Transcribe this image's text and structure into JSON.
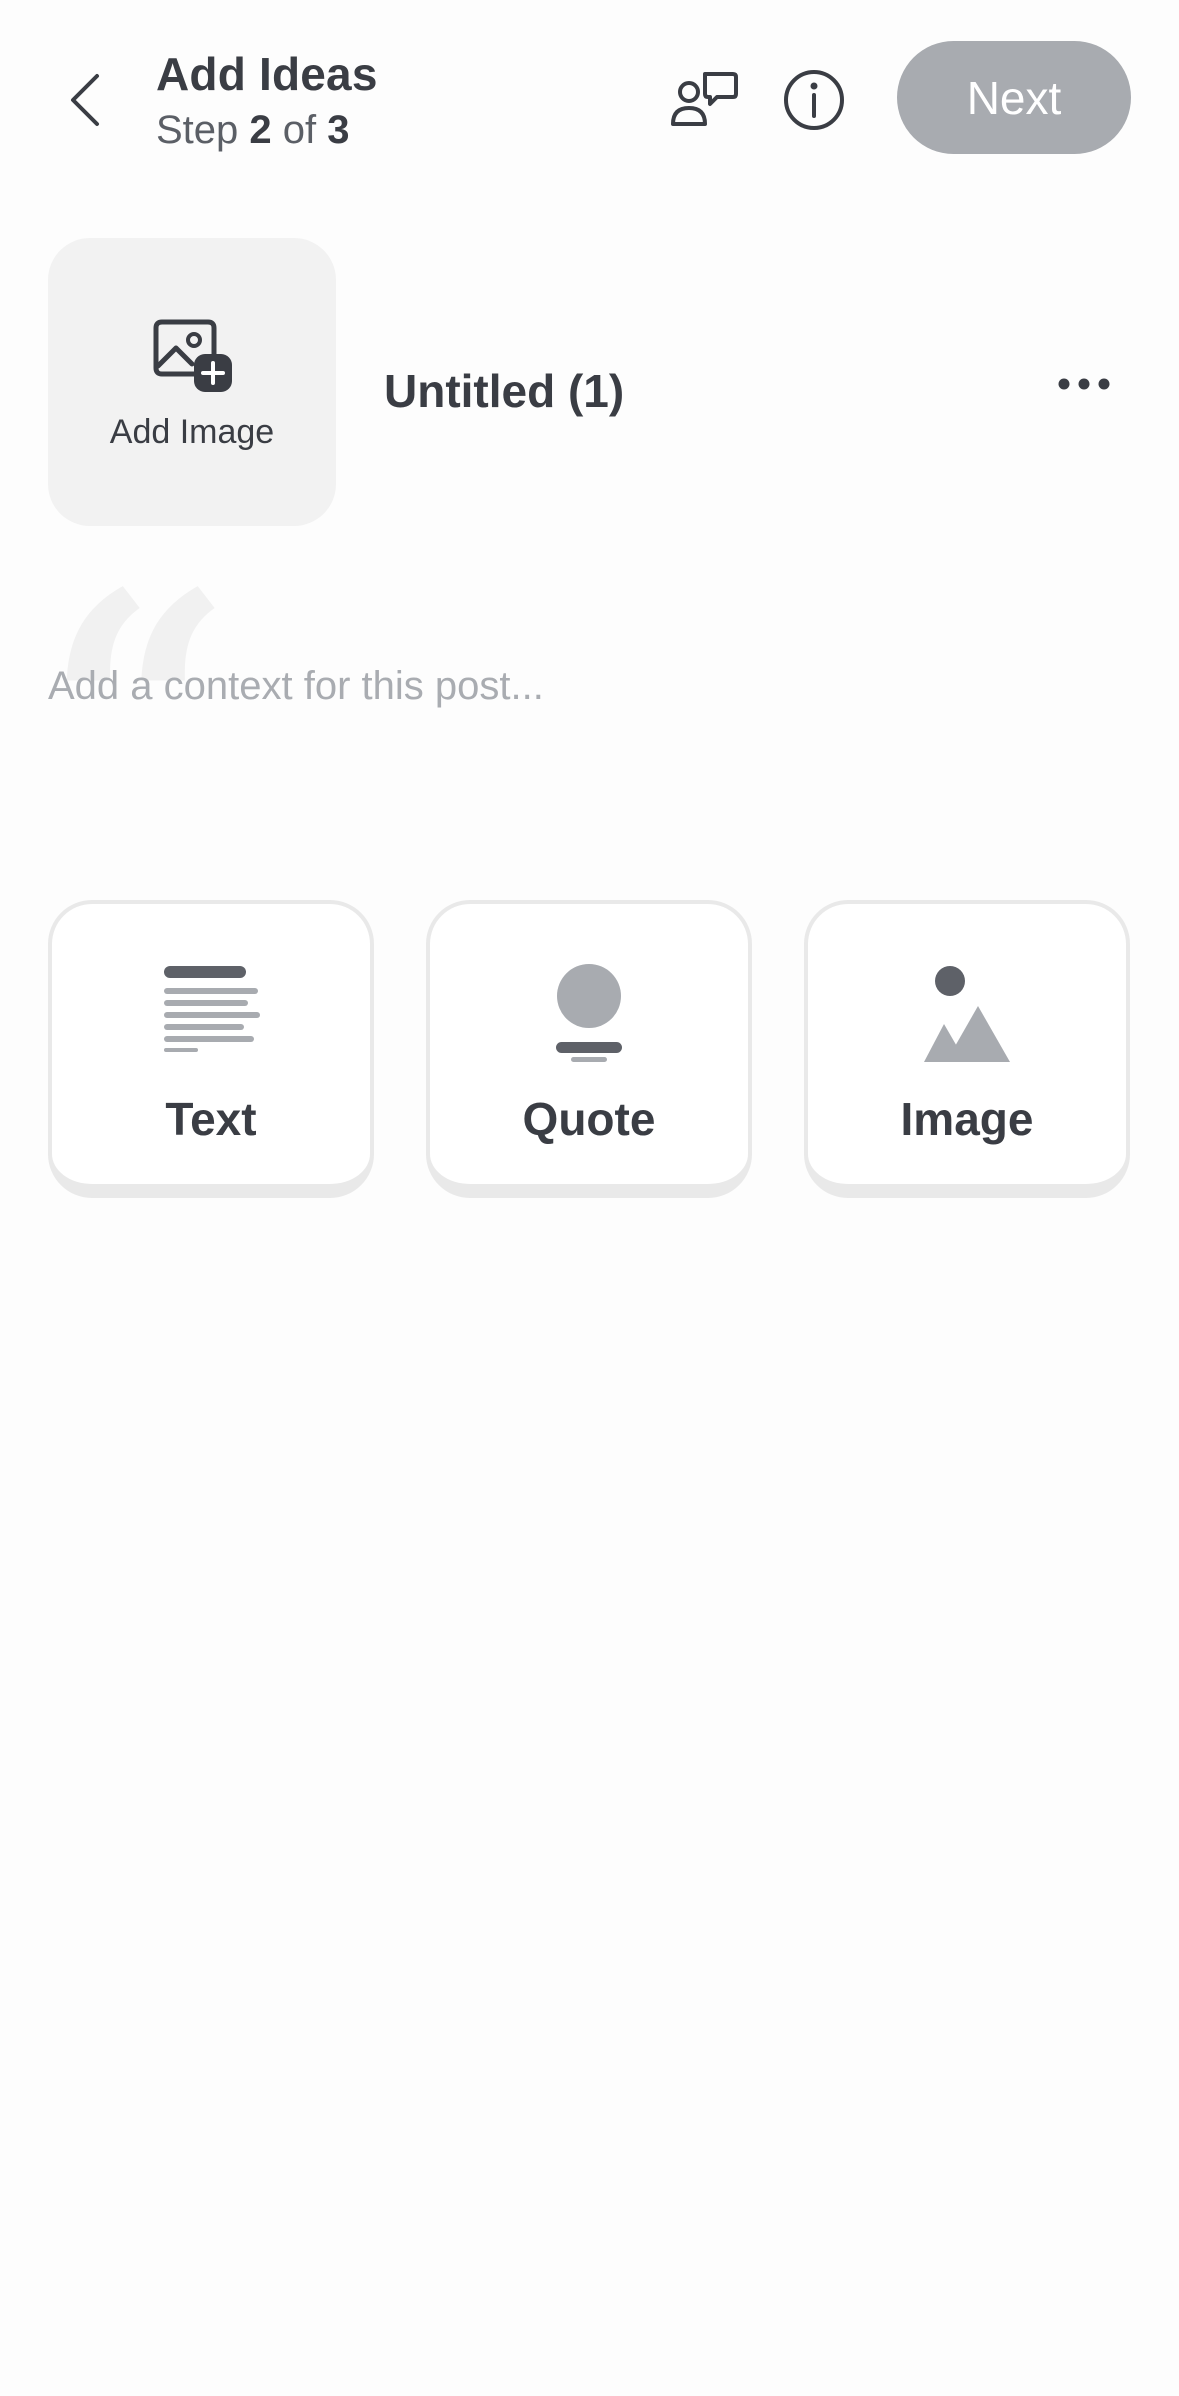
{
  "header": {
    "title": "Add Ideas",
    "step_label": "Step",
    "step_current": "2",
    "step_of": "of",
    "step_total": "3",
    "next_label": "Next"
  },
  "idea": {
    "cover_label": "Add Image",
    "title": "Untitled (1)",
    "context_placeholder": "Add a context for this post..."
  },
  "blocks": [
    {
      "label": "Text",
      "icon": "text-lines-icon"
    },
    {
      "label": "Quote",
      "icon": "quote-block-icon"
    },
    {
      "label": "Image",
      "icon": "mountain-image-icon"
    }
  ],
  "colors": {
    "next_disabled": "#a8abb0",
    "text_primary": "#3a3d44",
    "placeholder": "#a9acb1"
  }
}
